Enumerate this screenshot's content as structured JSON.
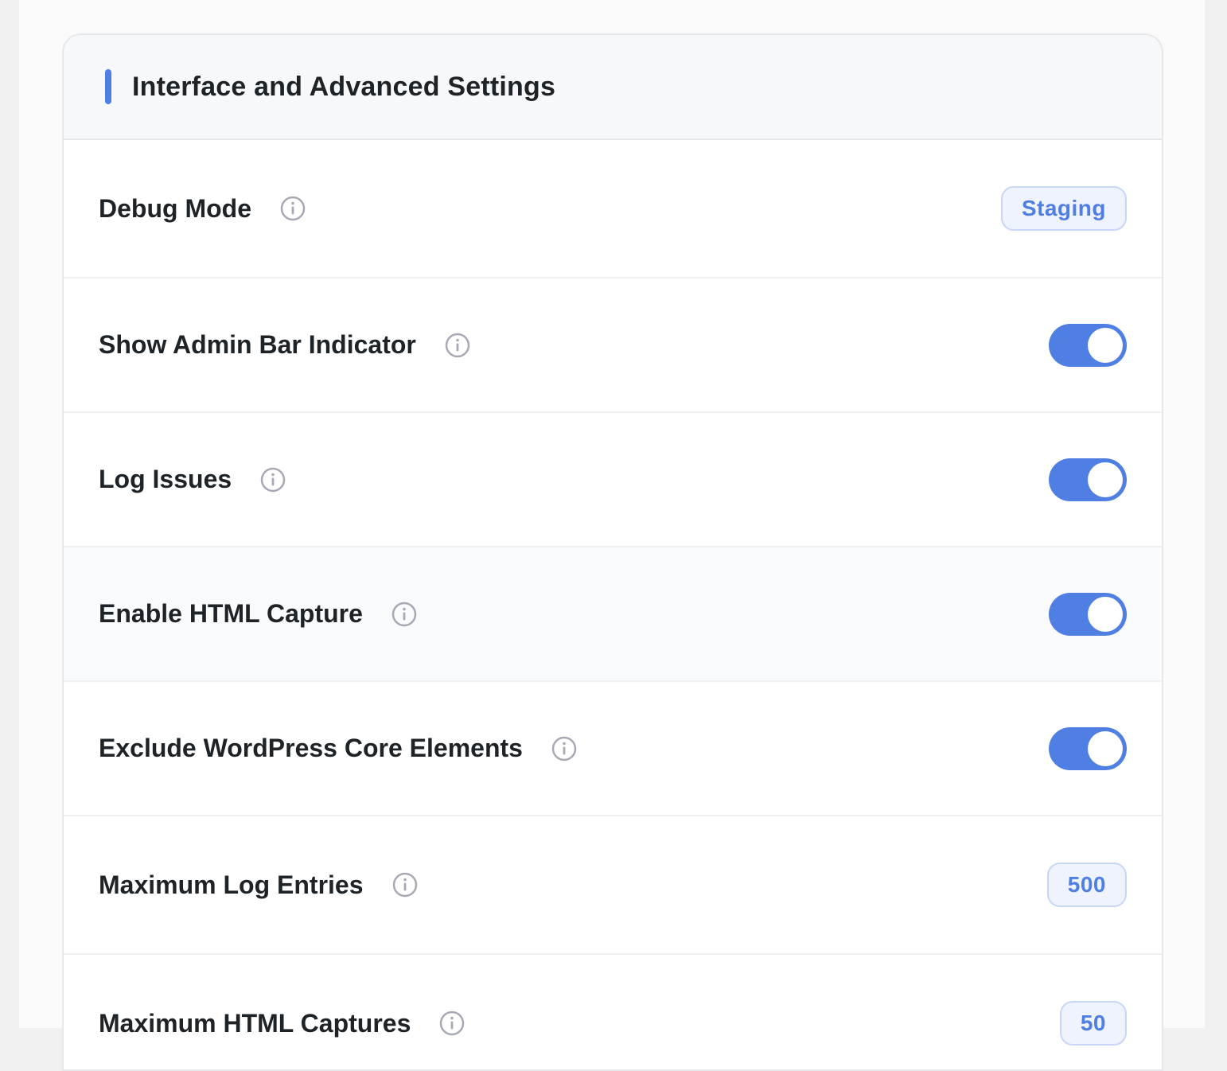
{
  "section": {
    "title": "Interface and Advanced Settings",
    "accent_color": "#4f7fe3"
  },
  "settings": [
    {
      "label": "Debug Mode",
      "control": "badge",
      "value": "Staging"
    },
    {
      "label": "Show Admin Bar Indicator",
      "control": "toggle",
      "value": "on"
    },
    {
      "label": "Log Issues",
      "control": "toggle",
      "value": "on"
    },
    {
      "label": "Enable HTML Capture",
      "control": "toggle",
      "value": "on"
    },
    {
      "label": "Exclude WordPress Core Elements",
      "control": "toggle",
      "value": "on"
    },
    {
      "label": "Maximum Log Entries",
      "control": "badge",
      "value": "500"
    },
    {
      "label": "Maximum HTML Captures",
      "control": "badge",
      "value": "50"
    }
  ],
  "icons": {
    "info": "info-circle-icon"
  }
}
